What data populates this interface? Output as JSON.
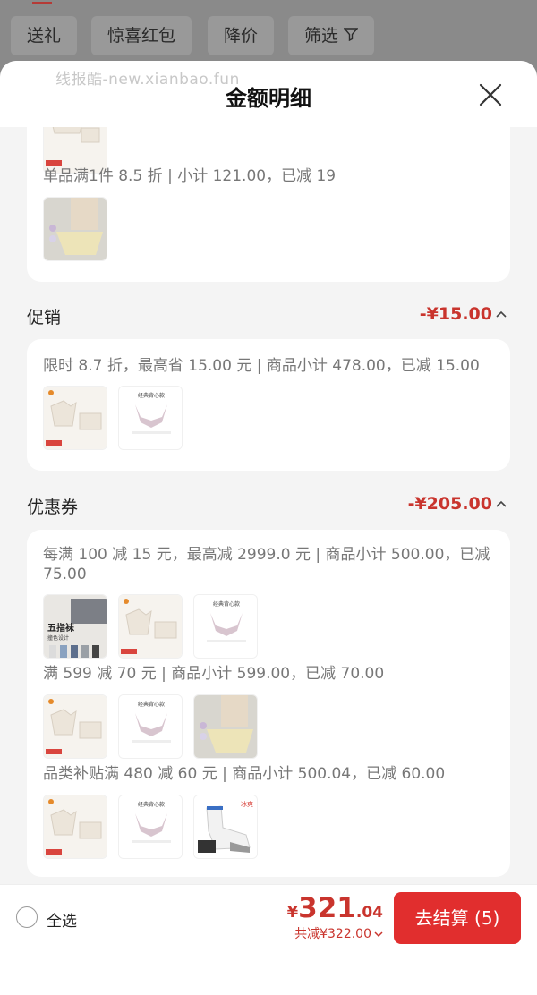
{
  "topbar": {
    "chips": [
      {
        "label": "送礼"
      },
      {
        "label": "惊喜红包"
      },
      {
        "label": "降价"
      },
      {
        "label": "筛选"
      }
    ]
  },
  "sheet": {
    "watermark": "线报酷-new.xianbao.fun",
    "title": "金额明细"
  },
  "card1": {
    "rule": "单品满1件 8.5 折 | 小计 121.00，已减 19"
  },
  "promotion": {
    "title": "促销",
    "amount": "-¥15.00",
    "rules": [
      {
        "text": "限时 8.7 折，最高省 15.00 元 | 商品小计 478.00，已减 15.00"
      }
    ]
  },
  "coupon": {
    "title": "优惠券",
    "amount": "-¥205.00",
    "rules": [
      {
        "text": "每满 100 减 15 元，最高减 2999.0 元 | 商品小计 500.00，已减 75.00"
      },
      {
        "text": "满 599 减 70 元 | 商品小计 599.00，已减 70.00"
      },
      {
        "text": "品类补贴满 480 减 60 元 | 商品小计 500.04，已减 60.00"
      }
    ]
  },
  "thumb_text": {
    "socks_title": "五指袜",
    "socks_sub": "撞色设计",
    "bra_title": "经典背心款",
    "brand_tag": "279",
    "socks_tag": "冰爽"
  },
  "footer": {
    "select_all": "全选",
    "price_symbol": "¥",
    "price_int": "321",
    "price_dec": ".04",
    "saved": "共减¥322.00",
    "checkout": "去结算 (5)"
  },
  "colors": {
    "accent": "#e12e2e",
    "amount": "#c9342d"
  },
  "icons": [
    "filter-icon",
    "close-icon",
    "chevron-up-icon",
    "chevron-down-icon"
  ]
}
